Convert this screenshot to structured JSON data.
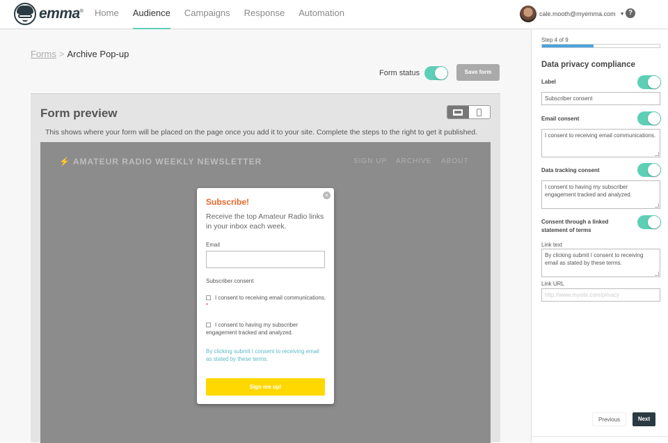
{
  "brand": {
    "name": "emma",
    "mark": "®"
  },
  "nav": {
    "items": [
      "Home",
      "Audience",
      "Campaigns",
      "Response",
      "Automation"
    ],
    "active": "Audience"
  },
  "user": {
    "email": "cale.mooth@myemma.com"
  },
  "help": {
    "glyph": "?"
  },
  "breadcrumb": {
    "link": "Forms",
    "separator": ">",
    "current": "Archive Pop-up"
  },
  "form_status": {
    "label": "Form status",
    "enabled": true
  },
  "save_button": "Save form",
  "preview": {
    "title": "Form preview",
    "description": "This shows where your form will be placed on the page once you add it to your site. Complete the steps to the right to get it published.",
    "device_options": [
      "desktop-icon",
      "mobile-icon"
    ],
    "device_selected": "desktop-icon"
  },
  "site": {
    "logo": "AMATEUR RADIO WEEKLY NEWSLETTER",
    "nav": [
      "SIGN UP",
      "ARCHIVE",
      "ABOUT"
    ]
  },
  "popup": {
    "close": "×",
    "title": "Subscribe!",
    "subtitle": "Receive the top Amateur Radio links in your inbox each week.",
    "email_label": "Email",
    "consent_heading": "Subscriber consent",
    "email_consent": "I consent to receiving email communications.",
    "required_mark": "*",
    "tracking_consent": "I consent to having my subscriber engagement tracked and analyzed.",
    "terms": "By clicking submit I consent to receiving email as stated by these terms.",
    "submit": "Sign me up!"
  },
  "sidebar": {
    "step": "Step 4 of 9",
    "progress": 0.44,
    "title": "Data privacy compliance",
    "label_label": "Label",
    "label_value": "Subscriber consent",
    "email_consent_label": "Email consent",
    "email_consent_value": "I consent to receiving email communications.",
    "tracking_label": "Data tracking consent",
    "tracking_value": "I consent to having my subscriber engagement tracked and analyzed.",
    "linked_terms_label": "Consent through a linked statement of terms",
    "link_text_label": "Link text",
    "link_text_value": "By clicking submit I consent to receiving email as stated by these terms.",
    "link_url_label": "Link URL",
    "link_url_placeholder": "http://www.mysite.com/privacy",
    "previous": "Previous",
    "next": "Next"
  },
  "colors": {
    "accent": "#5ecfb7",
    "brand_dark": "#2b3a42",
    "popup_title": "#e8662a",
    "submit": "#ffd800",
    "progress": "#4aa3df"
  }
}
